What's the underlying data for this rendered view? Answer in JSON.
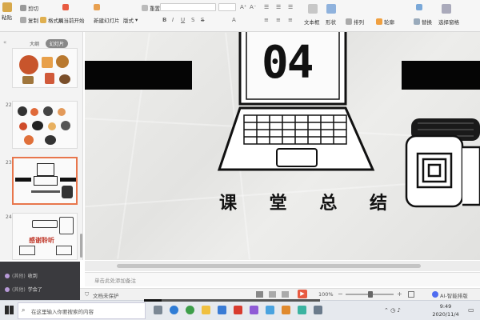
{
  "ribbon": {
    "paste": "粘贴",
    "cut": "剪切",
    "copy": "复制",
    "format_painter": "格式刷",
    "play_from_current": "从当前开始",
    "new_slide": "新建幻灯片",
    "layout": "版式",
    "reset": "重置",
    "text_box": "文本框",
    "shape": "形状",
    "arrange": "排列",
    "outline": "轮廓",
    "replace": "替换",
    "select_pane": "选择窗格"
  },
  "sidebar": {
    "tabs": [
      "大纲",
      "幻灯片"
    ],
    "slide_numbers": [
      "22",
      "23",
      "24"
    ],
    "thumb24_text": "感谢聆听"
  },
  "slide": {
    "number": "04",
    "title_chars": [
      "课",
      "堂",
      "总",
      "结"
    ]
  },
  "chat": [
    {
      "who": "(其他) ",
      "text": "收到"
    },
    {
      "who": "(其他) ",
      "text": "学会了"
    }
  ],
  "notes": {
    "placeholder": "单击此处添加备注"
  },
  "status": {
    "protection": "文档未保护",
    "zoom": "100%",
    "ai_label": "AI-智能排版"
  },
  "taskbar": {
    "search_placeholder": "在这里输入你要搜索的内容",
    "time": "9:49",
    "date": "2020/11/4"
  },
  "colors": {
    "accent_orange": "#e8764c",
    "play_red": "#e85a40",
    "chat_bg": "#3a3a3e"
  }
}
